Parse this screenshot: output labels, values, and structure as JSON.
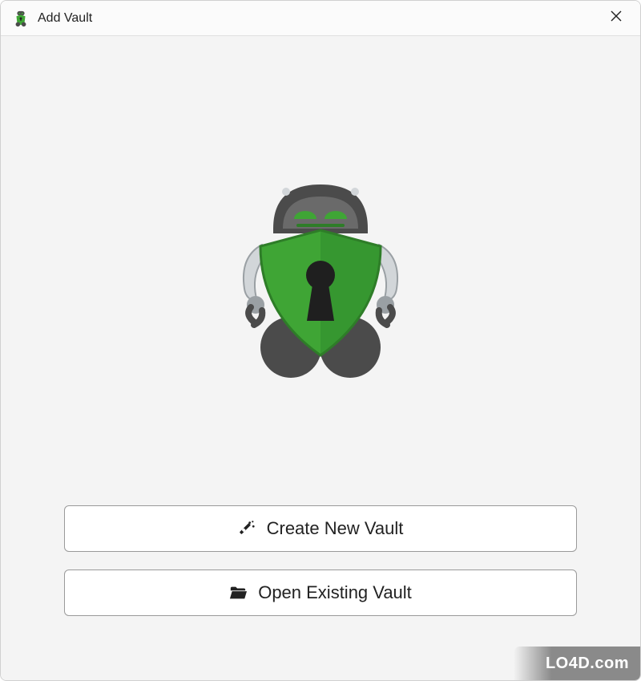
{
  "window": {
    "title": "Add Vault",
    "icons": {
      "app": "cryptomator-icon",
      "close": "close-icon"
    }
  },
  "main": {
    "logo": "cryptomator-robot",
    "buttons": {
      "create": {
        "label": "Create New Vault",
        "icon": "magic-wand-icon"
      },
      "open": {
        "label": "Open Existing Vault",
        "icon": "folder-open-icon"
      }
    }
  },
  "watermark": "LO4D.com",
  "colors": {
    "accent_green": "#3fa535",
    "accent_green_dark": "#2e7d28",
    "robot_grey": "#4b4b4b",
    "robot_light": "#d2d6d9",
    "window_bg": "#f4f4f4"
  }
}
